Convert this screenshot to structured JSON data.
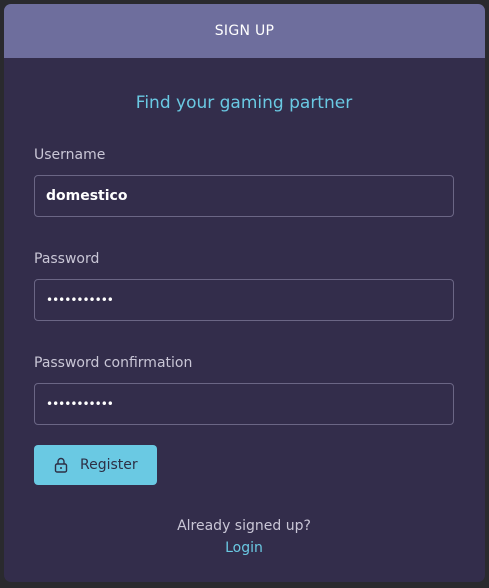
{
  "header": {
    "title": "SIGN UP"
  },
  "tagline": "Find your gaming partner",
  "form": {
    "username_label": "Username",
    "username_value": "domestico",
    "password_label": "Password",
    "password_value": "•••••••••••",
    "confirm_label": "Password confirmation",
    "confirm_value": "•••••••••••",
    "register_label": "Register",
    "register_icon": "lock-icon"
  },
  "footer": {
    "question": "Already signed up?",
    "login_link": "Login"
  },
  "colors": {
    "header_bg": "#6e6e9d",
    "card_bg": "#332d4b",
    "accent": "#6ac9e3"
  }
}
